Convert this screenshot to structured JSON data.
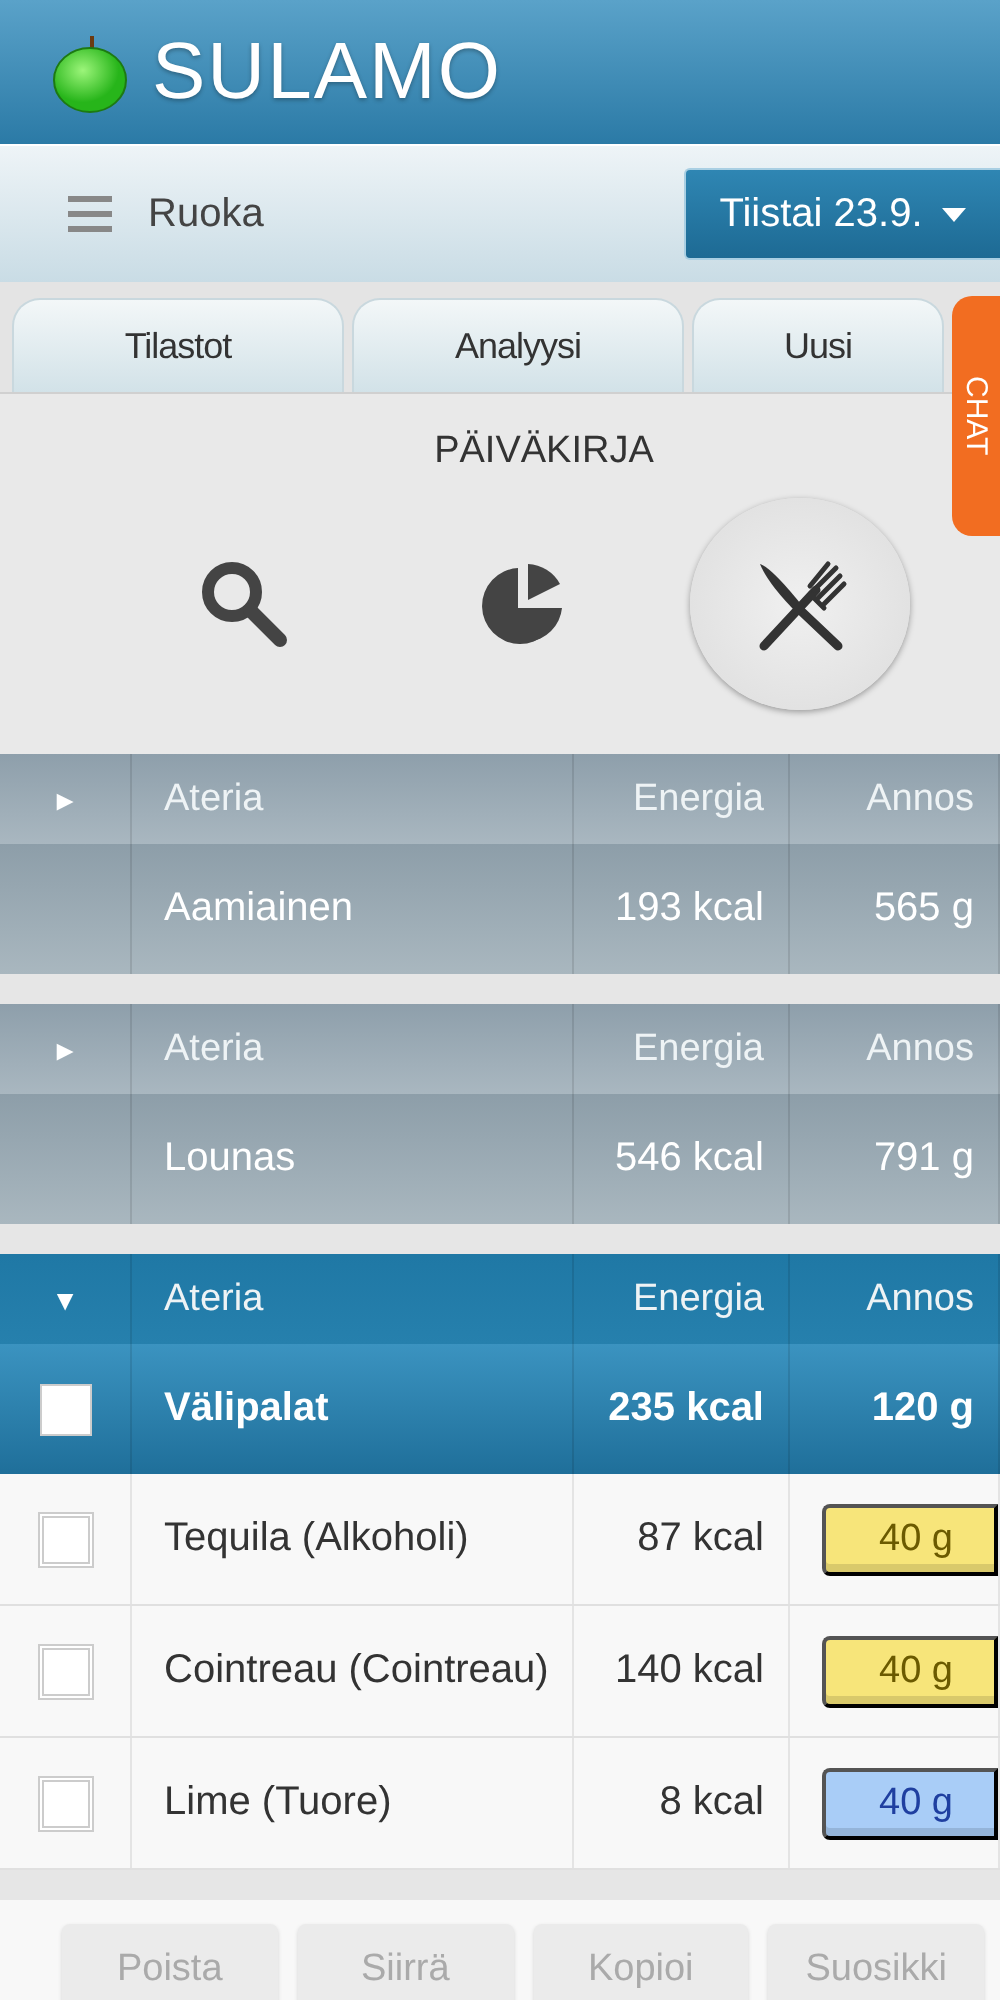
{
  "app": {
    "title": "SULAMO"
  },
  "toolbar": {
    "section": "Ruoka",
    "date": "Tiistai 23.9."
  },
  "tabs": [
    {
      "label": "Tilastot",
      "selected": false
    },
    {
      "label": "Analyysi",
      "selected": false
    },
    {
      "label": "Uusi",
      "selected": false
    }
  ],
  "chat_tab": {
    "label": "CHAT"
  },
  "diary": {
    "title": "PÄIVÄKIRJA",
    "views": [
      {
        "kind": "search",
        "selected": false
      },
      {
        "kind": "chart",
        "selected": false
      },
      {
        "kind": "meals",
        "selected": true
      }
    ]
  },
  "meals": [
    {
      "toggle": "►",
      "expanded": false,
      "columns": [
        "Ateria",
        "Energia",
        "Annos"
      ],
      "name": "Aamiainen",
      "energy": "193 kcal",
      "portion": "565 g"
    },
    {
      "toggle": "►",
      "expanded": false,
      "columns": [
        "Ateria",
        "Energia",
        "Annos"
      ],
      "name": "Lounas",
      "energy": "546 kcal",
      "portion": "791 g"
    },
    {
      "toggle": "▼",
      "expanded": true,
      "columns": [
        "Ateria",
        "Energia",
        "Annos"
      ],
      "name": "Välipalat",
      "energy": "235 kcal",
      "portion": "120 g",
      "checked": false,
      "items": [
        {
          "name": "Tequila (Alkoholi)",
          "energy": "87 kcal",
          "portion": "40 g",
          "color": "#f7e57a",
          "checked": false
        },
        {
          "name": "Cointreau (Cointreau)",
          "energy": "140 kcal",
          "portion": "40 g",
          "color": "#f7e57a",
          "checked": false
        },
        {
          "name": "Lime (Tuore)",
          "energy": "8 kcal",
          "portion": "40 g",
          "color": "#a9cdf7",
          "checked": false
        }
      ]
    }
  ],
  "actions": [
    {
      "label": "Poista",
      "disabled": true
    },
    {
      "label": "Siirrä",
      "disabled": true
    },
    {
      "label": "Kopioi",
      "disabled": true
    },
    {
      "label": "Suosikki",
      "disabled": true
    }
  ]
}
